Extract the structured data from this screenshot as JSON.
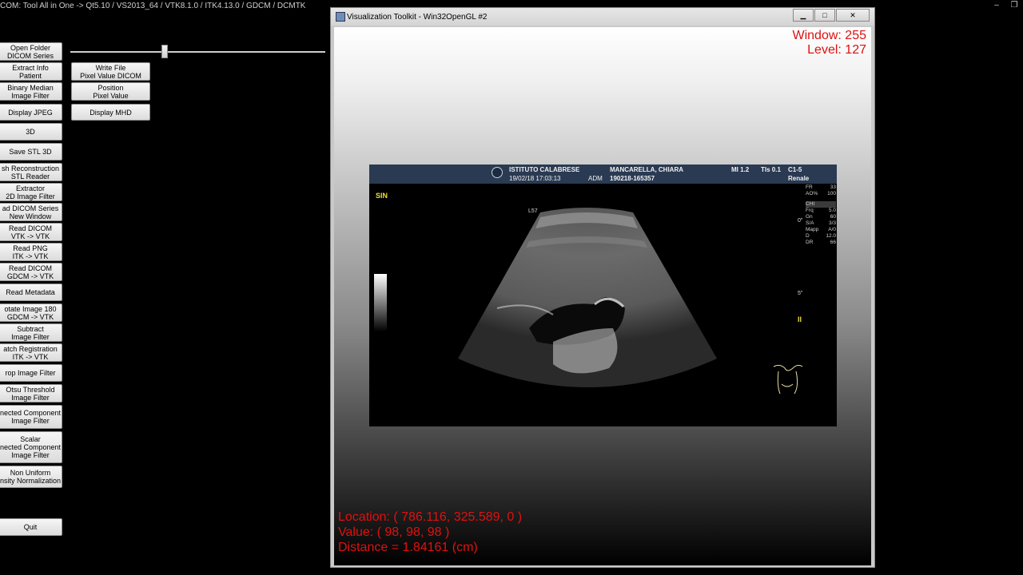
{
  "app_title": "COM: Tool All in One -> Qt5.10 / VS2013_64 / VTK8.1.0 / ITK4.13.0 / GDCM / DCMTK",
  "top_controls": [
    "–",
    "❐"
  ],
  "left_buttons": [
    {
      "l1": "Open Folder",
      "l2": "DICOM Series"
    },
    {
      "l1": "Extract Info",
      "l2": "Patient"
    },
    {
      "l1": "Binary Median",
      "l2": "Image Filter"
    },
    {
      "l1": "Display JPEG",
      "l2": ""
    },
    {
      "l1": "3D",
      "l2": ""
    },
    {
      "l1": "Save STL 3D",
      "l2": ""
    },
    {
      "l1": "sh Reconstruction",
      "l2": "STL Reader"
    },
    {
      "l1": "Extractor",
      "l2": "2D Image Filter"
    },
    {
      "l1": "ad DICOM Series",
      "l2": "New Window"
    },
    {
      "l1": "Read DICOM",
      "l2": "VTK -> VTK"
    },
    {
      "l1": "Read PNG",
      "l2": "ITK -> VTK"
    },
    {
      "l1": "Read DICOM",
      "l2": "GDCM -> VTK"
    },
    {
      "l1": "Read Metadata",
      "l2": ""
    },
    {
      "l1": "otate Image 180",
      "l2": "GDCM -> VTK"
    },
    {
      "l1": "Subtract",
      "l2": "Image Filter"
    },
    {
      "l1": "atch Registration",
      "l2": "ITK -> VTK"
    },
    {
      "l1": "rop Image Filter",
      "l2": ""
    },
    {
      "l1": "Otsu Threshold",
      "l2": "Image Filter"
    },
    {
      "l1": "nected Component",
      "l2": "Image Filter"
    },
    {
      "l1": "Scalar",
      "l2": "nected Component",
      "l3": "Image Filter"
    },
    {
      "l1": "Non Uniform",
      "l2": "nsity Normalization"
    },
    {
      "l1": "Quit",
      "l2": ""
    }
  ],
  "second_col_buttons": [
    {
      "l1": "Write File",
      "l2": "Pixel Value DICOM"
    },
    {
      "l1": "Position",
      "l2": "Pixel Value"
    },
    {
      "l1": "Display MHD",
      "l2": ""
    }
  ],
  "slider": {
    "value_fraction": 0.37
  },
  "vtk_window": {
    "title": "Visualization Toolkit - Win32OpenGL #2",
    "buttons": {
      "min": "▁",
      "max": "□",
      "close": "✕"
    },
    "window_level": {
      "window": "Window: 255",
      "level": "Level: 127"
    },
    "info": {
      "location": "Location: ( 786.116, 325.589, 0 )",
      "value": "Value: ( 98, 98, 98 )",
      "distance": "Distance = 1.84161 (cm)"
    }
  },
  "ultrasound": {
    "institute": "ISTITUTO CALABRESE",
    "datetime": "19/02/18 17:03:13",
    "adm": "ADM",
    "patient": "MANCARELLA, CHIARA",
    "id": "190218-165357",
    "mi": "MI 1.2",
    "tis": "TIs 0.1",
    "probe": "C1-5",
    "preset": "Renale",
    "side": "SIN",
    "depth_label": "L57",
    "marker_0": "0\"",
    "marker_5": "5\"",
    "params": [
      {
        "k": "FR",
        "v": "33"
      },
      {
        "k": "AO%",
        "v": "100"
      },
      {
        "k": "CHI",
        "v": ""
      },
      {
        "k": "Frq",
        "v": "5.0"
      },
      {
        "k": "Gn",
        "v": "60"
      },
      {
        "k": "S/A",
        "v": "3/3"
      },
      {
        "k": "Mapp",
        "v": "A/0"
      },
      {
        "k": "D",
        "v": "12.0"
      },
      {
        "k": "DR",
        "v": "66"
      }
    ]
  }
}
